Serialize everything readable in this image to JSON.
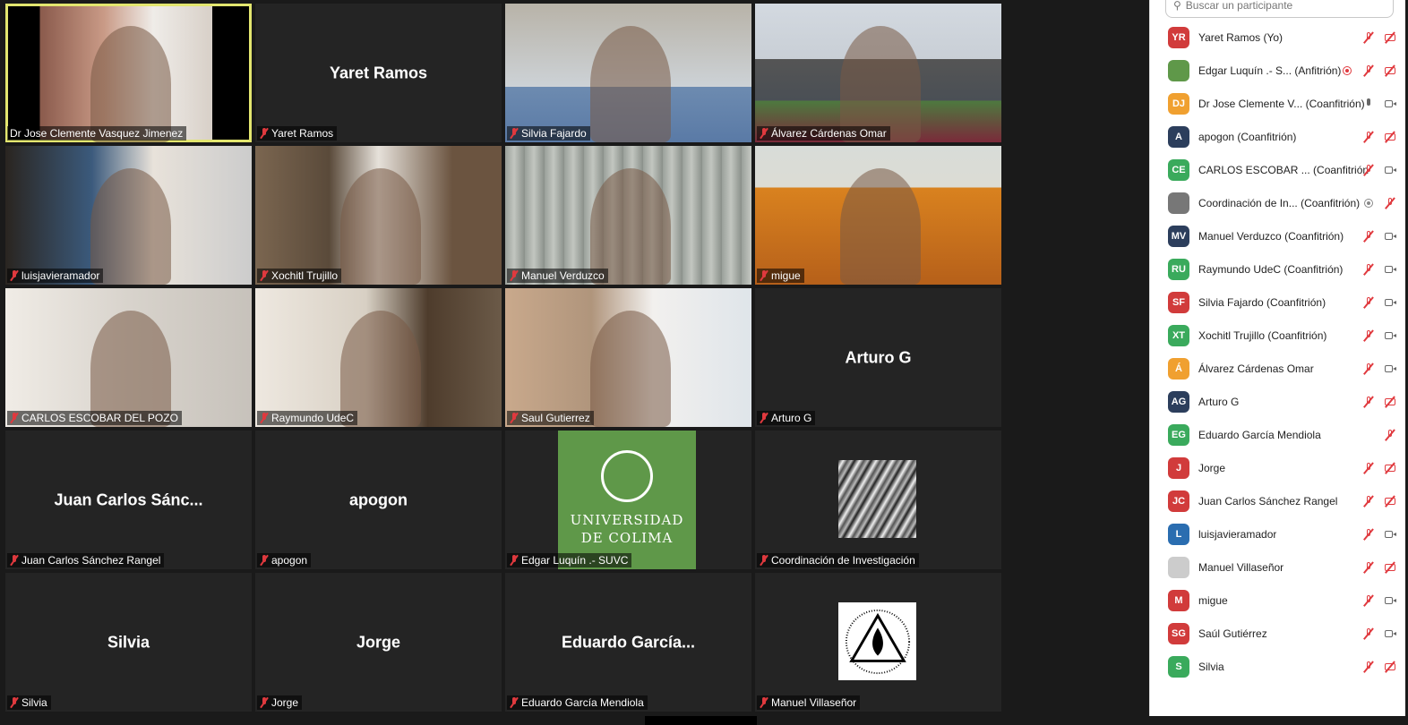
{
  "tiles": [
    {
      "name": "Dr Jose Clemente Vasquez Jimenez",
      "big": "",
      "video": "v1",
      "speaking": true,
      "muted": false
    },
    {
      "name": "Yaret Ramos",
      "big": "Yaret Ramos",
      "video": "",
      "muted": true
    },
    {
      "name": "Silvia Fajardo",
      "big": "",
      "video": "v3",
      "muted": true
    },
    {
      "name": "Álvarez Cárdenas Omar",
      "big": "",
      "video": "v4",
      "muted": true
    },
    {
      "name": "luisjavieramador",
      "big": "",
      "video": "v5",
      "muted": true
    },
    {
      "name": "Xochitl Trujillo",
      "big": "",
      "video": "v6",
      "muted": true
    },
    {
      "name": "Manuel Verduzco",
      "big": "",
      "video": "v7",
      "muted": true
    },
    {
      "name": "migue",
      "big": "",
      "video": "v8",
      "muted": true
    },
    {
      "name": "CARLOS ESCOBAR DEL POZO",
      "big": "",
      "video": "v9",
      "muted": true
    },
    {
      "name": "Raymundo UdeC",
      "big": "",
      "video": "v10",
      "muted": true
    },
    {
      "name": "Saul Gutierrez",
      "big": "",
      "video": "v11",
      "muted": true
    },
    {
      "name": "Arturo G",
      "big": "Arturo G",
      "video": "",
      "muted": true
    },
    {
      "name": "Juan Carlos Sánchez Rangel",
      "big": "Juan Carlos Sánc...",
      "video": "",
      "muted": true
    },
    {
      "name": "apogon",
      "big": "apogon",
      "video": "",
      "muted": true
    },
    {
      "name": "Edgar Luquín .- SUVC",
      "big": "",
      "video": "udec",
      "muted": true
    },
    {
      "name": "Coordinación de Investigación",
      "big": "",
      "video": "shell",
      "muted": true
    },
    {
      "name": "Silvia",
      "big": "Silvia",
      "video": "",
      "muted": true
    },
    {
      "name": "Jorge",
      "big": "Jorge",
      "video": "",
      "muted": true
    },
    {
      "name": "Eduardo García Mendiola",
      "big": "Eduardo García...",
      "video": "",
      "muted": true
    },
    {
      "name": "Manuel Villaseñor",
      "big": "",
      "video": "mason",
      "muted": true
    }
  ],
  "udec_logo": {
    "line1": "UNIVERSIDAD",
    "line2": "DE COLIMA"
  },
  "panel": {
    "search_placeholder": "Buscar un participante",
    "participants": [
      {
        "initials": "YR",
        "color": "#d13b3b",
        "name": "Yaret Ramos (Yo)",
        "role": "",
        "icons": [
          "mic-off",
          "cam-off"
        ]
      },
      {
        "initials": "",
        "color": "#5f9849",
        "name": "Edgar Luquín .- S...",
        "role": "(Anfitrión)",
        "icons": [
          "rec",
          "mic-off",
          "cam-off"
        ]
      },
      {
        "initials": "DJ",
        "color": "#f0a030",
        "name": "Dr Jose Clemente V...",
        "role": "(Coanfitrión)",
        "icons": [
          "mic",
          "cam"
        ]
      },
      {
        "initials": "A",
        "color": "#2c3e5c",
        "name": "apogon",
        "role": "(Coanfitrión)",
        "icons": [
          "mic-off",
          "cam-off"
        ]
      },
      {
        "initials": "CE",
        "color": "#3aaa5c",
        "name": "CARLOS ESCOBAR ...",
        "role": "(Coanfitrión)",
        "icons": [
          "mic-off",
          "cam"
        ]
      },
      {
        "initials": "",
        "color": "#777777",
        "name": "Coordinación de In...",
        "role": "(Coanfitrión)",
        "icons": [
          "rec-grey",
          "mic-off"
        ]
      },
      {
        "initials": "MV",
        "color": "#2c3e5c",
        "name": "Manuel Verduzco",
        "role": "(Coanfitrión)",
        "icons": [
          "mic-off",
          "cam"
        ]
      },
      {
        "initials": "RU",
        "color": "#3aaa5c",
        "name": "Raymundo UdeC",
        "role": "(Coanfitrión)",
        "icons": [
          "mic-off",
          "cam"
        ]
      },
      {
        "initials": "SF",
        "color": "#d13b3b",
        "name": "Silvia Fajardo",
        "role": "(Coanfitrión)",
        "icons": [
          "mic-off",
          "cam"
        ]
      },
      {
        "initials": "XT",
        "color": "#3aaa5c",
        "name": "Xochitl Trujillo",
        "role": "(Coanfitrión)",
        "icons": [
          "mic-off",
          "cam"
        ]
      },
      {
        "initials": "Á",
        "color": "#f0a030",
        "name": "Álvarez Cárdenas Omar",
        "role": "",
        "icons": [
          "mic-off",
          "cam"
        ]
      },
      {
        "initials": "AG",
        "color": "#2c3e5c",
        "name": "Arturo G",
        "role": "",
        "icons": [
          "mic-off",
          "cam-off"
        ]
      },
      {
        "initials": "EG",
        "color": "#3aaa5c",
        "name": "Eduardo García Mendiola",
        "role": "",
        "icons": [
          "mic-off"
        ]
      },
      {
        "initials": "J",
        "color": "#d13b3b",
        "name": "Jorge",
        "role": "",
        "icons": [
          "mic-off",
          "cam-off"
        ]
      },
      {
        "initials": "JC",
        "color": "#d13b3b",
        "name": "Juan Carlos Sánchez Rangel",
        "role": "",
        "icons": [
          "mic-off",
          "cam-off"
        ]
      },
      {
        "initials": "L",
        "color": "#2a6db0",
        "name": "luisjavieramador",
        "role": "",
        "icons": [
          "mic-off",
          "cam"
        ]
      },
      {
        "initials": "",
        "color": "#cccccc",
        "name": "Manuel Villaseñor",
        "role": "",
        "icons": [
          "mic-off",
          "cam-off"
        ]
      },
      {
        "initials": "M",
        "color": "#d13b3b",
        "name": "migue",
        "role": "",
        "icons": [
          "mic-off",
          "cam"
        ]
      },
      {
        "initials": "SG",
        "color": "#d13b3b",
        "name": "Saúl Gutiérrez",
        "role": "",
        "icons": [
          "mic-off",
          "cam"
        ]
      },
      {
        "initials": "S",
        "color": "#3aaa5c",
        "name": "Silvia",
        "role": "",
        "icons": [
          "mic-off",
          "cam-off"
        ]
      }
    ]
  }
}
